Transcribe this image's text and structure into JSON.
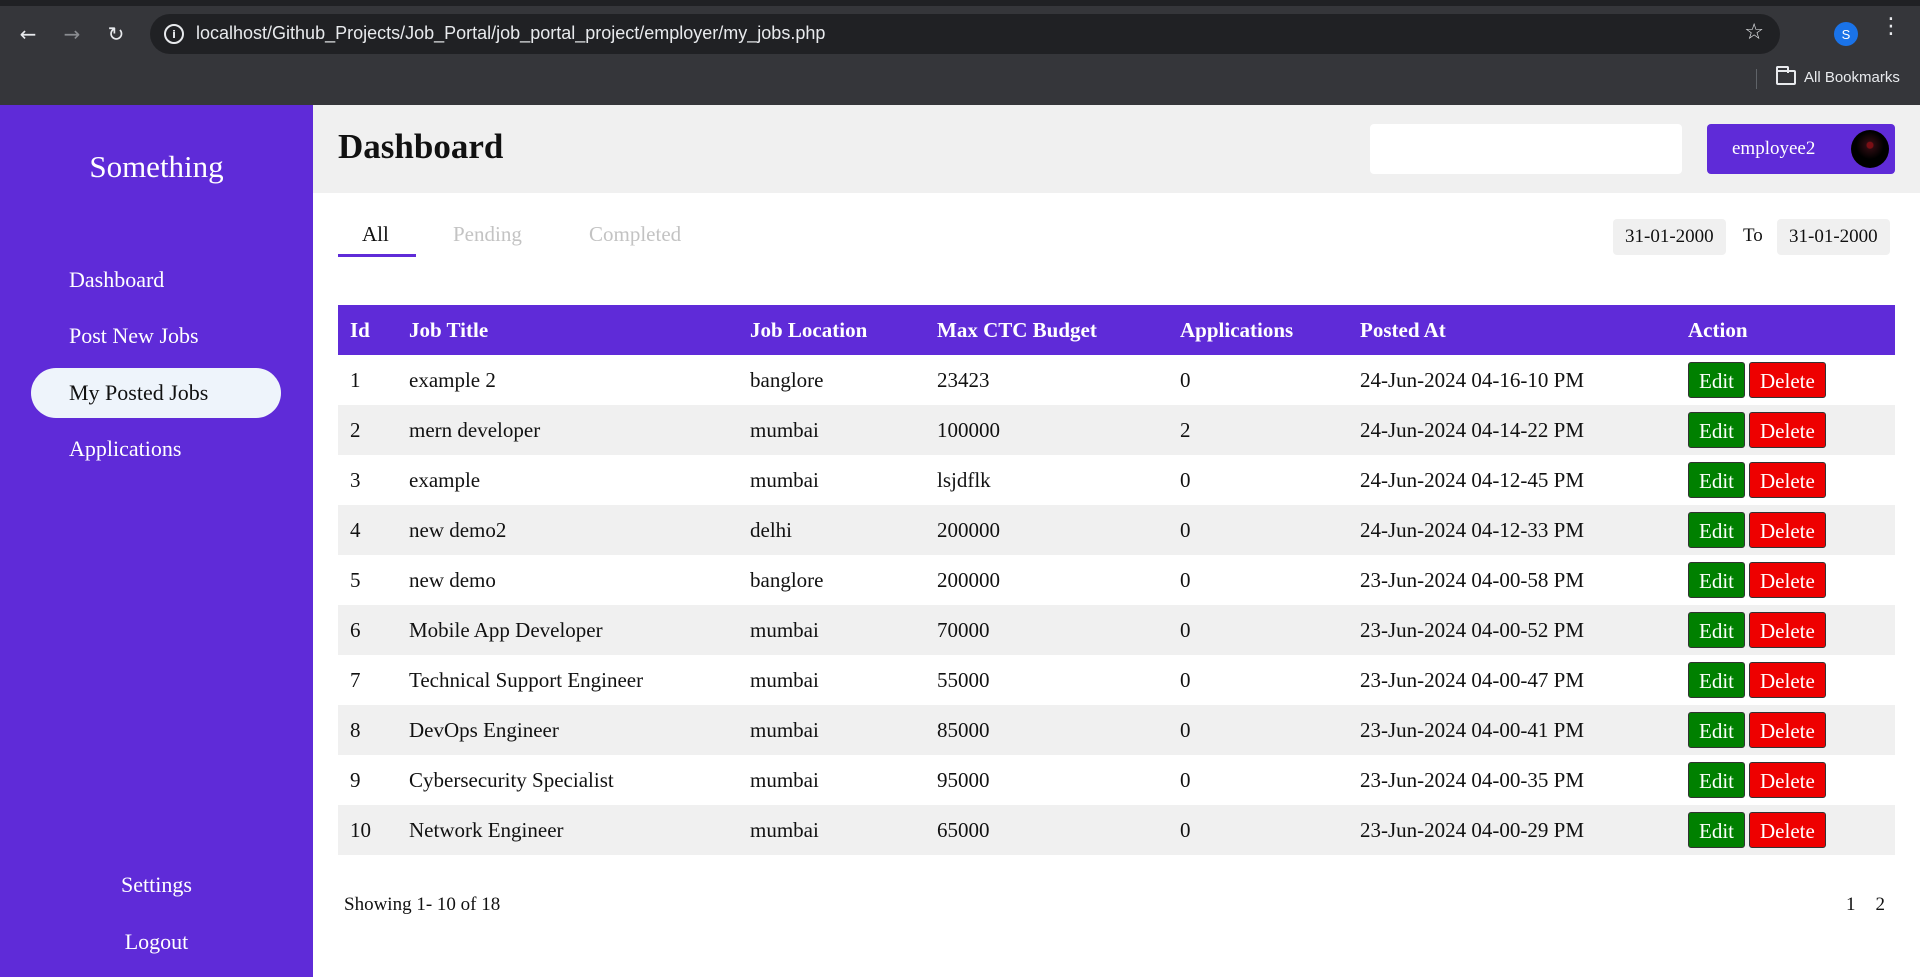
{
  "browser": {
    "url": "localhost/Github_Projects/Job_Portal/job_portal_project/employer/my_jobs.php",
    "profile_initial": "S",
    "bookmarks_label": "All Bookmarks"
  },
  "sidebar": {
    "brand": "Something",
    "items": [
      {
        "label": "Dashboard",
        "active": false
      },
      {
        "label": "Post New Jobs",
        "active": false
      },
      {
        "label": "My Posted Jobs",
        "active": true
      },
      {
        "label": "Applications",
        "active": false
      }
    ],
    "settings_label": "Settings",
    "logout_label": "Logout"
  },
  "header": {
    "title": "Dashboard",
    "search_placeholder": "",
    "user_name": "employee2"
  },
  "tabs": [
    {
      "label": "All",
      "active": true
    },
    {
      "label": "Pending",
      "active": false
    },
    {
      "label": "Completed",
      "active": false
    }
  ],
  "date_filter": {
    "from": "31-01-2000",
    "to_label": "To",
    "to": "31-01-2000"
  },
  "table": {
    "columns": [
      "Id",
      "Job Title",
      "Job Location",
      "Max CTC Budget",
      "Applications",
      "Posted At",
      "Action"
    ],
    "edit_label": "Edit",
    "delete_label": "Delete",
    "rows": [
      [
        "1",
        "example 2",
        "banglore",
        "23423",
        "0",
        "24-Jun-2024 04-16-10 PM"
      ],
      [
        "2",
        "mern developer",
        "mumbai",
        "100000",
        "2",
        "24-Jun-2024 04-14-22 PM"
      ],
      [
        "3",
        "example",
        "mumbai",
        "lsjdflk",
        "0",
        "24-Jun-2024 04-12-45 PM"
      ],
      [
        "4",
        "new demo2",
        "delhi",
        "200000",
        "0",
        "24-Jun-2024 04-12-33 PM"
      ],
      [
        "5",
        "new demo",
        "banglore",
        "200000",
        "0",
        "23-Jun-2024 04-00-58 PM"
      ],
      [
        "6",
        "Mobile App Developer",
        "mumbai",
        "70000",
        "0",
        "23-Jun-2024 04-00-52 PM"
      ],
      [
        "7",
        "Technical Support Engineer",
        "mumbai",
        "55000",
        "0",
        "23-Jun-2024 04-00-47 PM"
      ],
      [
        "8",
        "DevOps Engineer",
        "mumbai",
        "85000",
        "0",
        "23-Jun-2024 04-00-41 PM"
      ],
      [
        "9",
        "Cybersecurity Specialist",
        "mumbai",
        "95000",
        "0",
        "23-Jun-2024 04-00-35 PM"
      ],
      [
        "10",
        "Network Engineer",
        "mumbai",
        "65000",
        "0",
        "23-Jun-2024 04-00-29 PM"
      ]
    ]
  },
  "footer": {
    "showing": "Showing 1- 10 of 18",
    "pages": [
      "1",
      "2"
    ]
  },
  "colors": {
    "accent": "#5f2bd8",
    "edit": "#008000",
    "delete": "#ee0000"
  },
  "icons": [
    "back-arrow-icon",
    "forward-arrow-icon",
    "reload-icon",
    "site-info-icon",
    "bookmark-star-icon",
    "kebab-menu-icon",
    "folder-icon"
  ]
}
